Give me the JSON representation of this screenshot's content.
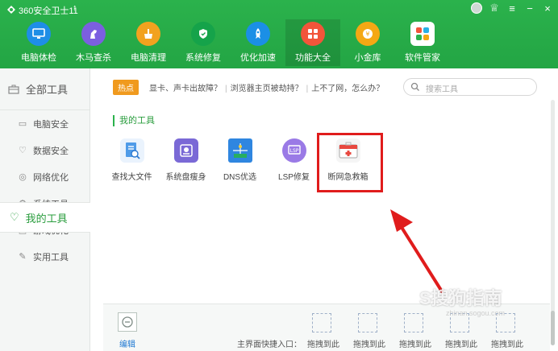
{
  "app": {
    "title": "360安全卫士11",
    "update_arrow": "↑",
    "controls": [
      "♕",
      "≡",
      "−",
      "×"
    ]
  },
  "nav": [
    {
      "label": "电脑体检",
      "icon": "monitor-icon",
      "color": "#1e8ee6"
    },
    {
      "label": "木马查杀",
      "icon": "horse-icon",
      "color": "#7b5fe0"
    },
    {
      "label": "电脑清理",
      "icon": "broom-icon",
      "color": "#f2a21f"
    },
    {
      "label": "系统修复",
      "icon": "shield-icon",
      "color": "#15a34a"
    },
    {
      "label": "优化加速",
      "icon": "rocket-icon",
      "color": "#1b8fe6"
    },
    {
      "label": "功能大全",
      "icon": "grid-icon",
      "color": "#f2553a"
    },
    {
      "label": "小金库",
      "icon": "coin-icon",
      "color": "#f4a814"
    },
    {
      "label": "软件管家",
      "icon": "apps-icon",
      "color": "#28b0e6"
    }
  ],
  "active_nav": "功能大全",
  "sidebar": {
    "header": "全部工具",
    "items": [
      {
        "label": "电脑安全",
        "icon": "computer-icon"
      },
      {
        "label": "数据安全",
        "icon": "heart-shield-icon"
      },
      {
        "label": "网络优化",
        "icon": "network-icon"
      },
      {
        "label": "系统工具",
        "icon": "gear-icon"
      },
      {
        "label": "游戏优化",
        "icon": "gamepad-icon"
      },
      {
        "label": "实用工具",
        "icon": "wrench-icon"
      }
    ],
    "active": "我的工具"
  },
  "hot": {
    "badge": "热点",
    "links": [
      "显卡、声卡出故障？",
      "浏览器主页被劫持？",
      "上不了网，怎么办？"
    ],
    "separator": "|"
  },
  "search": {
    "placeholder": "搜索工具"
  },
  "section": {
    "title": "我的工具"
  },
  "tools": [
    {
      "label": "查找大文件",
      "icon": "find-file-icon",
      "color": "#4f9be8"
    },
    {
      "label": "系统盘瘦身",
      "icon": "disk-icon",
      "color": "#7a69d6"
    },
    {
      "label": "DNS优选",
      "icon": "dns-icon",
      "color": "#2f86e0"
    },
    {
      "label": "LSP修复",
      "icon": "lsp-icon",
      "color": "#9a7ae6"
    },
    {
      "label": "断网急救箱",
      "icon": "first-aid-icon",
      "color": "#e8483f"
    }
  ],
  "bottom": {
    "edit_label": "编辑",
    "quick_label": "主界面快捷入口：",
    "slot_label": "拖拽到此",
    "slot_count": 5
  },
  "watermark": {
    "text": "S搜狗指南",
    "sub": "zhinan.sogou.com"
  },
  "colors": {
    "brand": "#2bb24c",
    "highlight": "#e01c1c"
  }
}
